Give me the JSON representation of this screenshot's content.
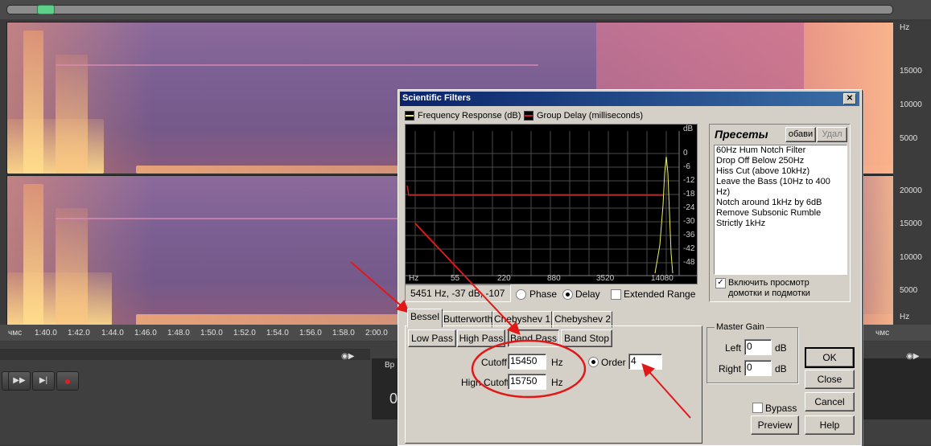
{
  "spectrogram": {
    "hz_label": "Hz",
    "hz_ticks_top": [
      "15000",
      "10000",
      "5000"
    ],
    "hz_ticks_bottom": [
      "20000",
      "15000",
      "10000",
      "5000"
    ],
    "hz_bottom_label": "Hz",
    "ruler": {
      "left_label": "чмс",
      "right_label": "чмс",
      "ticks": [
        "1:40.0",
        "1:42.0",
        "1:44.0",
        "1:46.0",
        "1:48.0",
        "1:50.0",
        "1:52.0",
        "1:54.0",
        "1:56.0",
        "1:58.0",
        "2:00.0"
      ]
    }
  },
  "transport": {
    "time_panel_label": "Вр",
    "time_panel_value": "0"
  },
  "dialog": {
    "title": "Scientific Filters",
    "close_glyph": "✕",
    "legend": {
      "freq_response": "Frequency Response (dB)",
      "group_delay": "Group Delay (milliseconds)"
    },
    "graph": {
      "db_label": "dB",
      "db_ticks": [
        "0",
        "-6",
        "-12",
        "-18",
        "-24",
        "-30",
        "-36",
        "-42",
        "-48"
      ],
      "freq_label": "Hz",
      "freq_ticks": [
        "55",
        "220",
        "880",
        "3520",
        "14080"
      ]
    },
    "status_text": "5451 Hz, -37 dB, -107",
    "phase_label": "Phase",
    "delay_label": "Delay",
    "extended_range_label": "Extended Range",
    "tabs": [
      "Bessel",
      "Butterworth",
      "Chebyshev 1",
      "Chebyshev 2"
    ],
    "filter_types": [
      "Low Pass",
      "High Pass",
      "Band Pass",
      "Band Stop"
    ],
    "cutoff_label": "Cutoff",
    "cutoff_value": "15450",
    "high_cutoff_label": "High Cutoff",
    "high_cutoff_value": "15750",
    "hz_unit": "Hz",
    "order_label": "Order",
    "order_value": "4",
    "presets": {
      "title": "Пресеты",
      "add_label": "обави",
      "delete_label": "Удал",
      "items": [
        "60Hz Hum Notch Filter",
        "Drop Off Below 250Hz",
        "Hiss Cut (above 10kHz)",
        "Leave the Bass (10Hz to 400 Hz)",
        "Notch around 1kHz by 6dB",
        "Remove Subsonic Rumble",
        "Strictly 1kHz"
      ],
      "preview_check_label_1": "Включить просмотр",
      "preview_check_label_2": "домотки и подмотки"
    },
    "master_gain": {
      "title": "Master Gain",
      "left_label": "Left",
      "left_value": "0",
      "right_label": "Right",
      "right_value": "0",
      "db_unit": "dB"
    },
    "buttons": {
      "ok": "OK",
      "close": "Close",
      "cancel": "Cancel",
      "help": "Help",
      "preview": "Preview",
      "bypass": "Bypass"
    }
  },
  "colors": {
    "annotation_red": "#e01818",
    "freq_response_line": "#f0f060",
    "group_delay_line": "#c82020"
  }
}
